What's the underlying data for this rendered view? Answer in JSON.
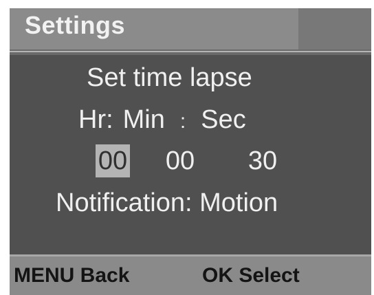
{
  "header": {
    "title": "Settings"
  },
  "content": {
    "heading": "Set time lapse",
    "unit_hr": "Hr:",
    "unit_min": "Min",
    "unit_sep": ":",
    "unit_sec": "Sec",
    "hours": "00",
    "minutes": "00",
    "seconds": "30",
    "notification": "Notification: Motion"
  },
  "footer": {
    "menu_hint": "MENU Back",
    "ok_hint": "OK Select"
  },
  "colors": {
    "background": "#505050",
    "header": "#8b8b8b",
    "selected_field": "#b4b4b4",
    "text": "#f0f0f0"
  }
}
